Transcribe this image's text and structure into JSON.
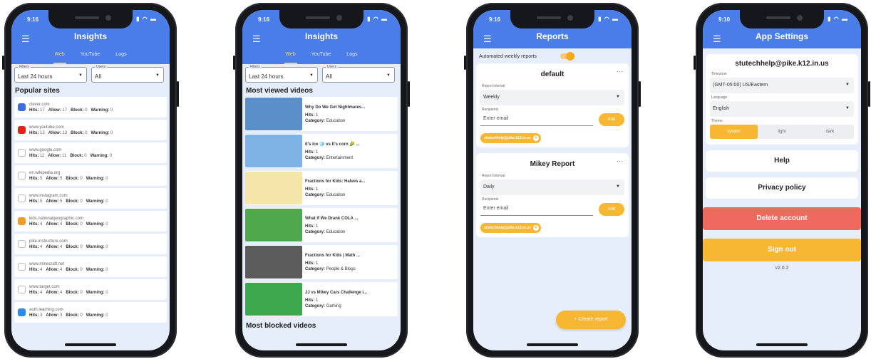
{
  "phones": [
    {
      "status_time": "9:16",
      "title": "Insights",
      "tabs": [
        "Web",
        "YouTube",
        "Logs"
      ],
      "active_tab": "Web",
      "filters": {
        "filters_label": "Filters",
        "filters_value": "Last 24 hours",
        "users_label": "Users",
        "users_value": "All"
      },
      "section": "Popular sites",
      "sites": [
        {
          "domain": "clever.com",
          "hits": "17",
          "allow": "17",
          "block": "0",
          "warning": "0",
          "icon": "clever-icon",
          "color": "#3d6be4"
        },
        {
          "domain": "www.youtube.com",
          "hits": "13",
          "allow": "13",
          "block": "0",
          "warning": "0",
          "icon": "youtube-icon",
          "color": "#e62117"
        },
        {
          "domain": "www.google.com",
          "hits": "11",
          "allow": "11",
          "block": "0",
          "warning": "0",
          "icon": "google-icon",
          "color": "#ffffff"
        },
        {
          "domain": "en.wikipedia.org",
          "hits": "5",
          "allow": "5",
          "block": "0",
          "warning": "0",
          "icon": "wikipedia-icon",
          "color": "#ffffff"
        },
        {
          "domain": "www.instagram.com",
          "hits": "5",
          "allow": "5",
          "block": "0",
          "warning": "0",
          "icon": "blocked-circle-icon",
          "color": "#ffffff"
        },
        {
          "domain": "kids.nationalgeographic.com",
          "hits": "4",
          "allow": "4",
          "block": "0",
          "warning": "0",
          "icon": "natgeo-icon",
          "color": "#f29b2a"
        },
        {
          "domain": "pike.instructure.com",
          "hits": "4",
          "allow": "4",
          "block": "0",
          "warning": "0",
          "icon": "canvas-icon",
          "color": "#ffffff"
        },
        {
          "domain": "www.minecraft.net",
          "hits": "4",
          "allow": "4",
          "block": "0",
          "warning": "0",
          "icon": "blocked-circle-icon",
          "color": "#ffffff"
        },
        {
          "domain": "www.target.com",
          "hits": "4",
          "allow": "4",
          "block": "0",
          "warning": "0",
          "icon": "target-icon",
          "color": "#ffffff"
        },
        {
          "domain": "auth.learning.com",
          "hits": "3",
          "allow": "3",
          "block": "0",
          "warning": "0",
          "icon": "learning-icon",
          "color": "#2e8ae6"
        }
      ],
      "stat_labels": {
        "hits": "Hits:",
        "allow": "Allow:",
        "block": "Block:",
        "warning": "Warning:"
      }
    },
    {
      "status_time": "9:16",
      "title": "Insights",
      "tabs": [
        "Web",
        "YouTube",
        "Logs"
      ],
      "active_tab": "Web",
      "filters": {
        "filters_label": "Filters",
        "filters_value": "Last 24 hours",
        "users_label": "Users",
        "users_value": "All"
      },
      "section": "Most viewed videos",
      "videos": [
        {
          "title": "Why Do We Get Nightmares...",
          "hits": "1",
          "category": "Education",
          "thumb": "#5a8fc9"
        },
        {
          "title": "It's Ice 🧊 vs It's corn 🌽 ...",
          "hits": "1",
          "category": "Entertainment",
          "thumb": "#7fb3e6"
        },
        {
          "title": "Fractions for Kids: Halves a...",
          "hits": "1",
          "category": "Education",
          "thumb": "#f4e6a8"
        },
        {
          "title": "What If We Drank COLA ...",
          "hits": "1",
          "category": "Education",
          "thumb": "#4fa84b"
        },
        {
          "title": "Fractions for Kids | Math ...",
          "hits": "1",
          "category": "People & Blogs",
          "thumb": "#5c5c5c"
        },
        {
          "title": "JJ vs Mikey Cars Challenge i...",
          "hits": "1",
          "category": "Gaming",
          "thumb": "#3ea84e"
        }
      ],
      "hits_label": "Hits:",
      "category_label": "Category:",
      "section2": "Most blocked videos"
    },
    {
      "status_time": "9:16",
      "title": "Reports",
      "toggle_label": "Automated weekly reports",
      "reports": [
        {
          "name": "default",
          "interval_label": "Report interval",
          "interval": "Weekly",
          "recipients_label": "Recipients",
          "email_placeholder": "Enter email",
          "add": "Add",
          "chip": "stutechhelp@pike.k12.in.us"
        },
        {
          "name": "Mikey Report",
          "interval_label": "Report interval",
          "interval": "Daily",
          "recipients_label": "Recipients",
          "email_placeholder": "Enter email",
          "add": "Add",
          "chip": "stutechhelp@pike.k12.in.us"
        }
      ],
      "fab": "+   Create report"
    },
    {
      "status_time": "9:10",
      "title": "App Settings",
      "email": "stutechhelp@pike.k12.in.us",
      "timezone_label": "Timezone",
      "timezone": "(GMT-05:00) US/Eastern",
      "language_label": "Language",
      "language": "English",
      "theme_label": "Theme",
      "themes": [
        "system",
        "light",
        "dark"
      ],
      "active_theme": "system",
      "help": "Help",
      "privacy": "Privacy policy",
      "delete": "Delete account",
      "signout": "Sign out",
      "version": "v2.0.2"
    }
  ]
}
